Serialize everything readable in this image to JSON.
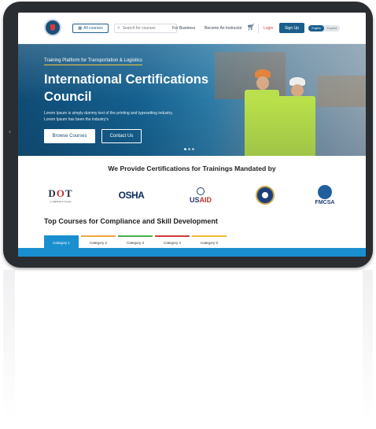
{
  "header": {
    "all_courses_label": "All courses",
    "search_placeholder": "Search for courses",
    "for_business": "For Business",
    "become_instructor": "Become An Instructor",
    "login": "Login",
    "signup": "Sign Up",
    "lang_english": "English",
    "lang_spanish": "Español",
    "icons": [
      "grid-icon",
      "search-icon",
      "cart-icon"
    ]
  },
  "hero": {
    "tagline": "Training Platform for Transportation & Logistics",
    "title": "International Certifications Council",
    "description": "Lorem Ipsum is simply dummy text of the printing and typesetting industry. Lorem Ipsum has been the industry's",
    "browse_button": "Browse Courses",
    "contact_button": "Contact Us",
    "slides": 3,
    "active_slide": 1
  },
  "partners": {
    "title": "We Provide Certifications for Trainings Mandated by",
    "logos": [
      {
        "name": "DOT",
        "mark_d": "D",
        "mark_o": "O",
        "mark_t": "T",
        "sub": "Compliance Group"
      },
      {
        "name": "OSHA",
        "mark": "OSHA"
      },
      {
        "name": "USAID",
        "mark_a": "US",
        "mark_b": "AID"
      },
      {
        "name": "CIA",
        "mark": ""
      },
      {
        "name": "FMCSA",
        "mark": "FMCSA"
      }
    ]
  },
  "courses": {
    "title": "Top Courses for Compliance and Skill Development",
    "tabs": [
      "Category 1",
      "Category 2",
      "Category 3",
      "Category 4",
      "Category 5"
    ],
    "active_tab": 0
  },
  "colors": {
    "brand": "#1b5e8c",
    "accent_blue": "#1a8fd0",
    "login_red": "#d64040"
  }
}
